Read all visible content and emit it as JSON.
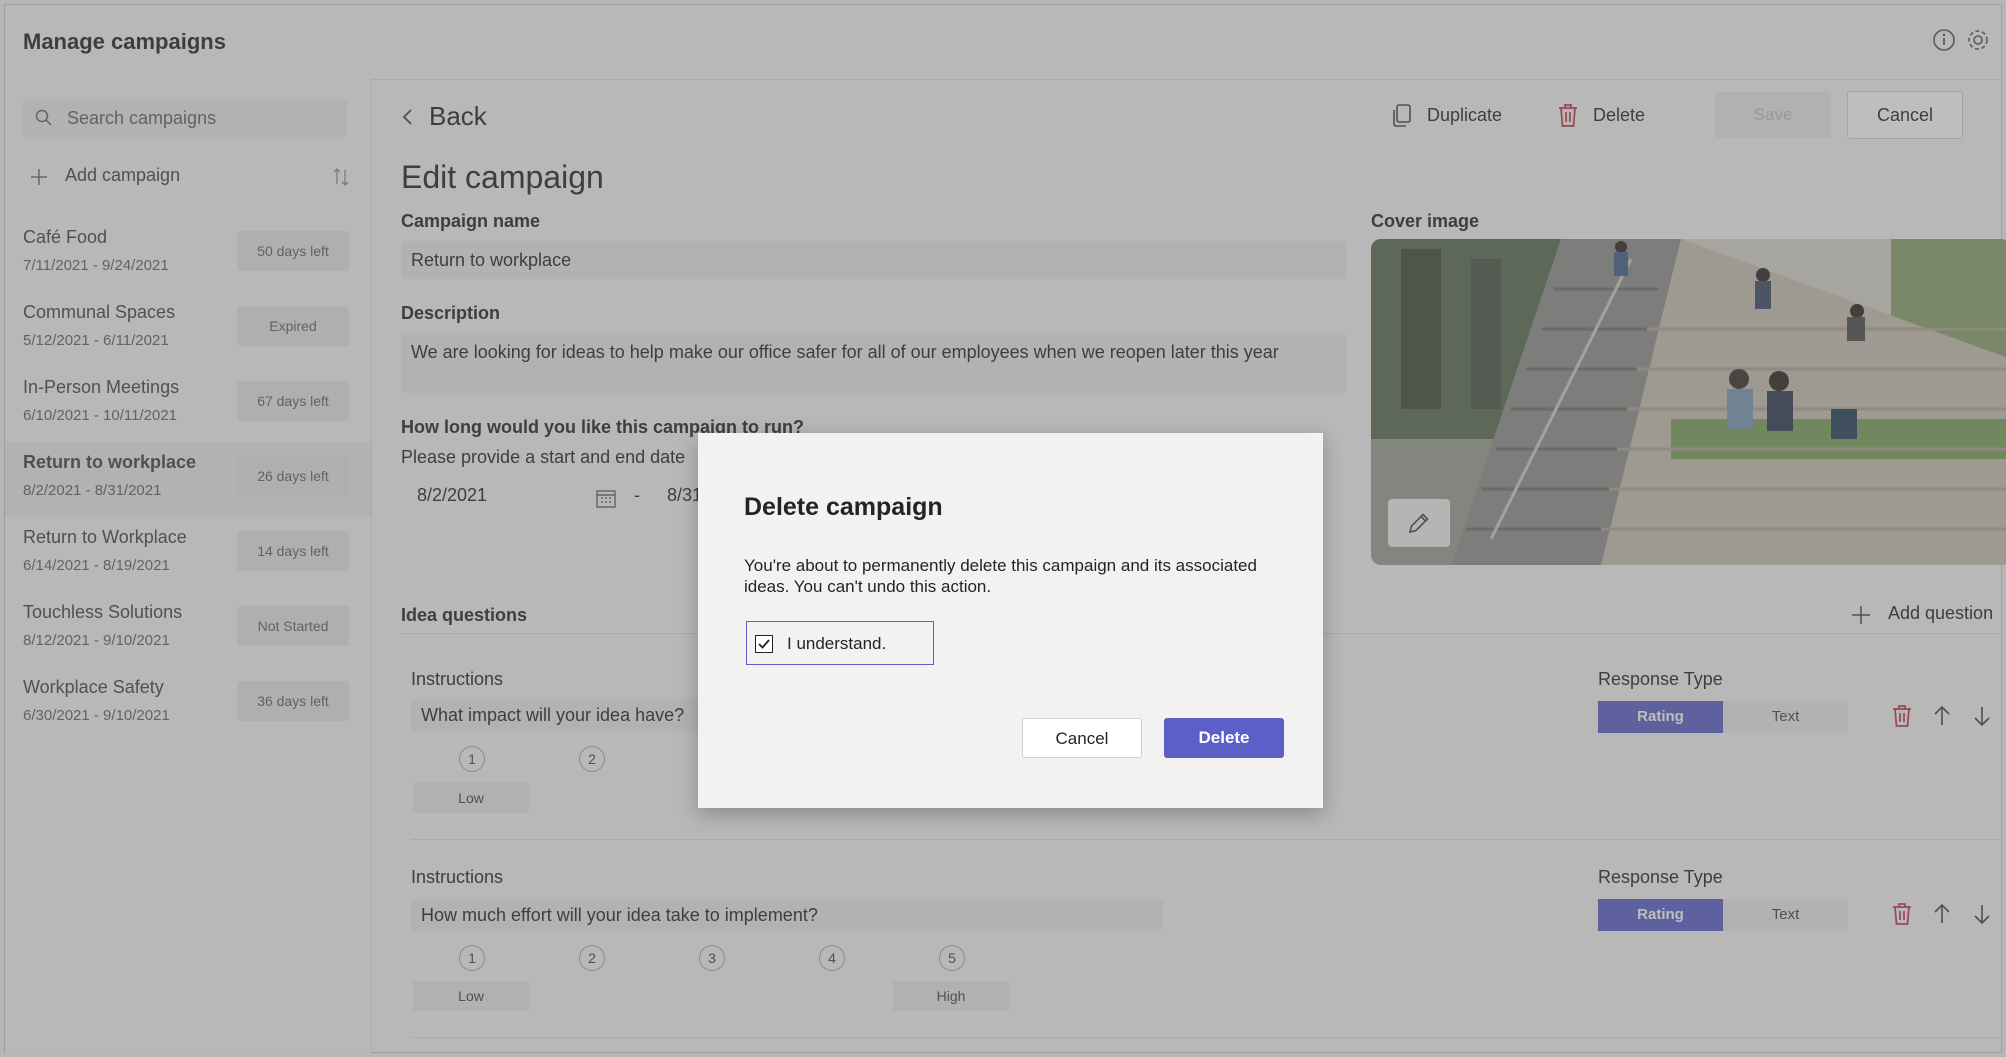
{
  "app": {
    "title": "Manage campaigns",
    "header_icons": [
      "info-icon",
      "settings-icon"
    ]
  },
  "sidebar": {
    "search_placeholder": "Search campaigns",
    "add_label": "Add campaign",
    "campaigns": [
      {
        "name": "Café Food",
        "dates": "7/11/2021 - 9/24/2021",
        "badge": "50 days left",
        "selected": false
      },
      {
        "name": "Communal Spaces",
        "dates": "5/12/2021 - 6/11/2021",
        "badge": "Expired",
        "selected": false
      },
      {
        "name": "In-Person Meetings",
        "dates": "6/10/2021 - 10/11/2021",
        "badge": "67 days left",
        "selected": false
      },
      {
        "name": "Return to workplace",
        "dates": "8/2/2021 - 8/31/2021",
        "badge": "26 days left",
        "selected": true
      },
      {
        "name": "Return to Workplace",
        "dates": "6/14/2021 - 8/19/2021",
        "badge": "14 days left",
        "selected": false
      },
      {
        "name": "Touchless Solutions",
        "dates": "8/12/2021 - 9/10/2021",
        "badge": "Not Started",
        "selected": false
      },
      {
        "name": "Workplace Safety",
        "dates": "6/30/2021 - 9/10/2021",
        "badge": "36 days left",
        "selected": false
      }
    ]
  },
  "toolbar": {
    "back": "Back",
    "duplicate": "Duplicate",
    "delete": "Delete",
    "save": "Save",
    "cancel": "Cancel"
  },
  "form": {
    "page_title": "Edit campaign",
    "name_label": "Campaign name",
    "name_value": "Return to workplace",
    "description_label": "Description",
    "description_value": "We are looking for ideas to help make our office safer for all of our employees when we reopen later this year",
    "duration_label": "How long would you like this campaign to run?",
    "duration_hint": "Please provide a start and end date",
    "start_date": "8/2/2021",
    "date_separator": "-",
    "end_date": "8/31,",
    "cover_label": "Cover image"
  },
  "questions": {
    "section_label": "Idea questions",
    "add_label": "Add question",
    "items": [
      {
        "instructions_label": "Instructions",
        "text": "What impact will your idea have?",
        "response_type_label": "Response Type",
        "types": [
          "Rating",
          "Text"
        ],
        "active_type": "Rating",
        "scale": [
          "1",
          "2"
        ],
        "low": "Low",
        "high": ""
      },
      {
        "instructions_label": "Instructions",
        "text": "How much effort will your idea take to implement?",
        "response_type_label": "Response Type",
        "types": [
          "Rating",
          "Text"
        ],
        "active_type": "Rating",
        "scale": [
          "1",
          "2",
          "3",
          "4",
          "5"
        ],
        "low": "Low",
        "high": "High"
      }
    ]
  },
  "dialog": {
    "title": "Delete campaign",
    "body": "You're about to permanently delete this campaign and its associated ideas. You can't undo this action.",
    "checkbox_label": "I understand.",
    "checkbox_checked": true,
    "cancel": "Cancel",
    "delete": "Delete"
  },
  "colors": {
    "accent": "#5b5fc7",
    "danger": "#c4314b",
    "overlay": "rgba(100,100,100,0.42)"
  }
}
